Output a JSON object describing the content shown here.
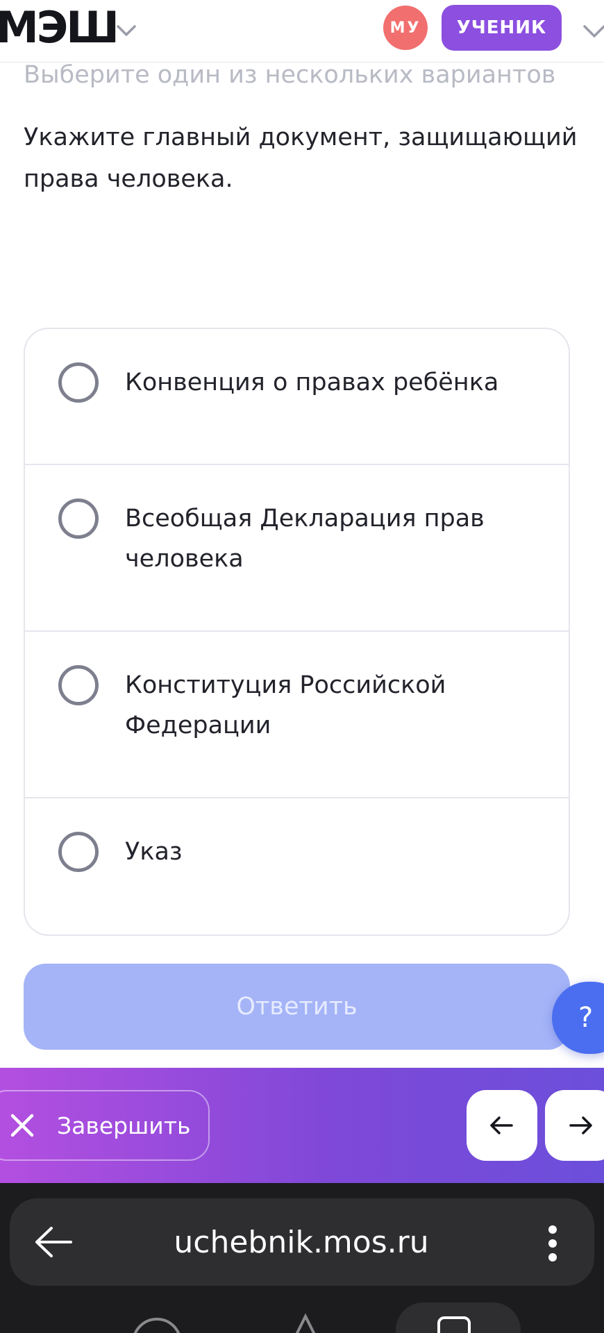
{
  "header": {
    "logo_text": "МЭШ",
    "avatar_initials": "МУ",
    "role_label": "УЧЕНИК"
  },
  "task": {
    "hint": "Выберите один из нескольких вариантов",
    "question": "Укажите главный документ, защищающий права человека."
  },
  "options": [
    {
      "label": "Конвенция о правах ребёнка"
    },
    {
      "label": "Всеобщая Декларация прав человека"
    },
    {
      "label": "Конституция Российской Федерации"
    },
    {
      "label": "Указ"
    }
  ],
  "submit_label": "Ответить",
  "help_label": "?",
  "action_bar": {
    "finish_label": "Завершить"
  },
  "browser": {
    "url": "uchebnik.mos.ru"
  },
  "colors": {
    "accent_purple": "#8c4fe0",
    "avatar_red": "#f26f6f",
    "submit_disabled": "#a5b4f7",
    "help_blue": "#4b6ef0"
  }
}
